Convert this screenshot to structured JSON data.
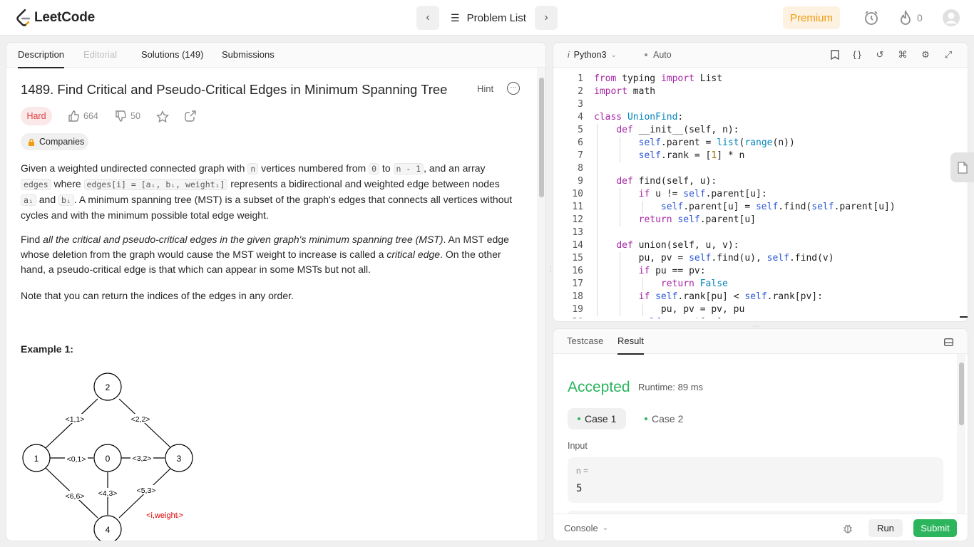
{
  "nav": {
    "logo_text": "LeetCode",
    "problem_list_label": "Problem List",
    "premium_label": "Premium",
    "streak_count": "0"
  },
  "left_tabs": [
    {
      "label": "Description"
    },
    {
      "label": "Editorial"
    },
    {
      "label": "Solutions (149)"
    },
    {
      "label": "Submissions"
    }
  ],
  "problem": {
    "title": "1489. Find Critical and Pseudo-Critical Edges in Minimum Spanning Tree",
    "hint_label": "Hint",
    "difficulty": "Hard",
    "likes": "664",
    "dislikes": "50",
    "companies_label": "Companies",
    "p1_a": "Given a weighted undirected connected graph with ",
    "p1_code_n": "n",
    "p1_b": " vertices numbered from ",
    "p1_code_0": "0",
    "p1_c": " to ",
    "p1_code_n1": "n - 1",
    "p1_d": ", and an array ",
    "p1_code_edges": "edges",
    "p1_e": " where ",
    "p1_code_edgesi": "edges[i] = [aᵢ, bᵢ, weightᵢ]",
    "p1_f": " represents a bidirectional and weighted edge between nodes ",
    "p1_code_ai": "aᵢ",
    "p1_g": " and ",
    "p1_code_bi": "bᵢ",
    "p1_h": ". A minimum spanning tree (MST) is a subset of the graph's edges that connects all vertices without cycles and with the minimum possible total edge weight.",
    "p2_a": "Find ",
    "p2_em": "all the critical and pseudo-critical edges in the given graph's minimum spanning tree (MST)",
    "p2_b": ". An MST edge whose deletion from the graph would cause the MST weight to increase is called a ",
    "p2_em2": "critical edge",
    "p2_c": ". On the other hand, a pseudo-critical edge is that which can appear in some MSTs but not all.",
    "p3": "Note that you can return the indices of the edges in any order.",
    "example_title": "Example 1:"
  },
  "graph": {
    "nodes": [
      "2",
      "1",
      "0",
      "3",
      "4"
    ],
    "edge_labels": [
      "<1,1>",
      "<2,2>",
      "<0,1>",
      "<3,2>",
      "<6,6>",
      "<4,3>",
      "<5,3>"
    ],
    "legend": "<i,weightᵢ>"
  },
  "editor": {
    "language": "Python3",
    "mode": "Auto",
    "lines": [
      "from typing import List",
      "import math",
      "",
      "class UnionFind:",
      "    def __init__(self, n):",
      "        self.parent = list(range(n))",
      "        self.rank = [1] * n",
      "",
      "    def find(self, u):",
      "        if u != self.parent[u]:",
      "            self.parent[u] = self.find(self.parent[u])",
      "        return self.parent[u]",
      "",
      "    def union(self, u, v):",
      "        pu, pv = self.find(u), self.find(v)",
      "        if pu == pv:",
      "            return False",
      "        if self.rank[pu] < self.rank[pv]:",
      "            pu, pv = pv, pu",
      "        self.parent[pv] = pu"
    ]
  },
  "result": {
    "tabs": [
      "Testcase",
      "Result"
    ],
    "status": "Accepted",
    "runtime": "Runtime: 89 ms",
    "cases": [
      "Case 1",
      "Case 2"
    ],
    "input_label": "Input",
    "input_var": "n =",
    "input_val": "5",
    "console_label": "Console",
    "run_label": "Run",
    "submit_label": "Submit"
  },
  "colors": {
    "accent_green": "#2db55d",
    "hard_red": "#e04040",
    "premium_orange": "#f29b0c"
  }
}
